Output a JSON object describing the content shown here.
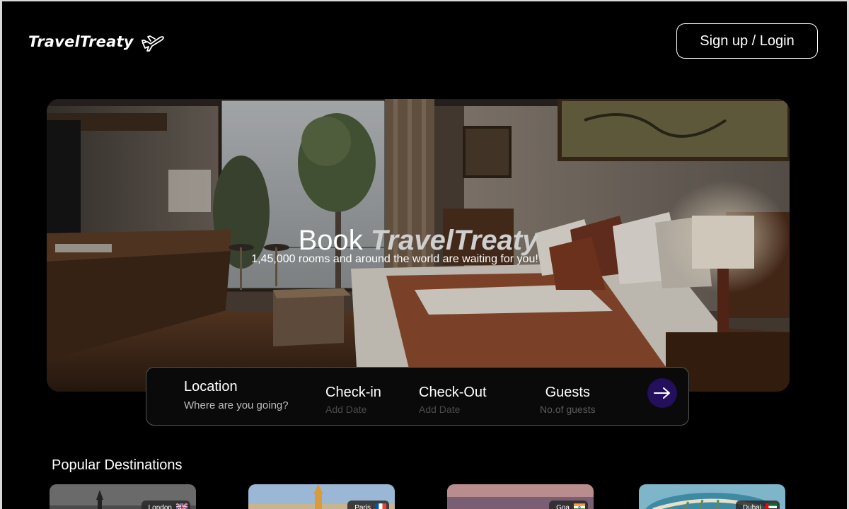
{
  "header": {
    "logo_text": "TravelTreaty",
    "logo_icon": "airplane-icon",
    "auth_label": "Sign up /  Login"
  },
  "hero": {
    "title_prefix": "Book ",
    "title_brand": "TravelTreaty",
    "subtitle": "1,45,000 rooms and around the world are waiting for you!"
  },
  "search": {
    "location_label": "Location",
    "location_placeholder": "Where are you going?",
    "checkin_label": "Check-in",
    "checkin_placeholder": "Add Date",
    "checkout_label": "Check-Out",
    "checkout_placeholder": "Add Date",
    "guests_label": "Guests",
    "guests_placeholder": "No.of guests",
    "submit_icon": "arrow-right-icon",
    "accent_color": "#240f5c"
  },
  "popular": {
    "title": "Popular Destinations",
    "cards": [
      {
        "name": "London",
        "flag_icon": "uk-flag-icon"
      },
      {
        "name": "Paris",
        "flag_icon": "france-flag-icon"
      },
      {
        "name": "Goa",
        "flag_icon": "india-flag-icon"
      },
      {
        "name": "Dubai",
        "flag_icon": "uae-flag-icon"
      }
    ]
  }
}
